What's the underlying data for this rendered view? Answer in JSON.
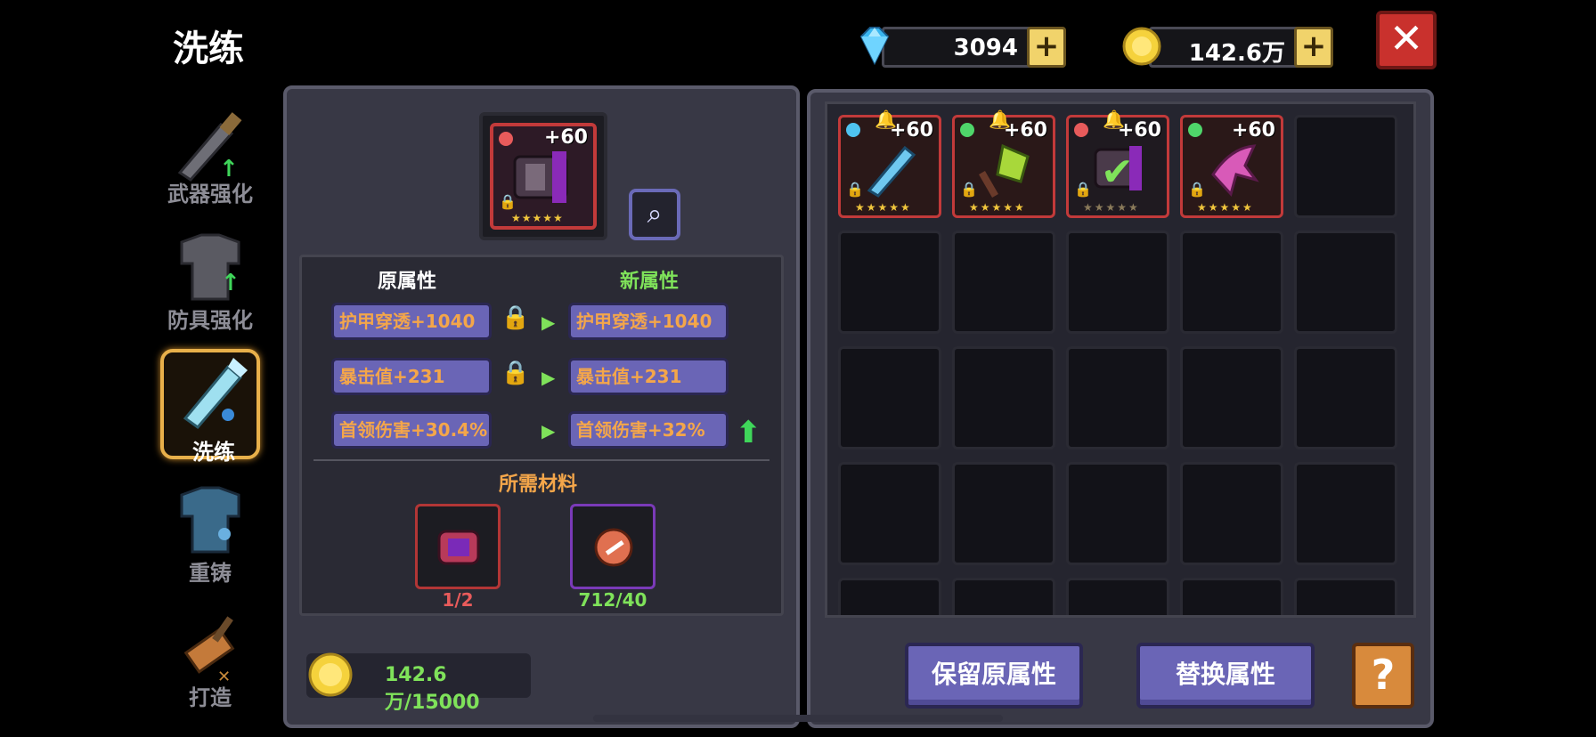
{
  "title": "洗练",
  "currency": {
    "gems": "3094",
    "gold": "142.6万",
    "plus_label": "+"
  },
  "close_label": "✕",
  "nav": [
    {
      "label": "武器强化",
      "icon": "sword-upgrade-icon"
    },
    {
      "label": "防具强化",
      "icon": "armor-upgrade-icon"
    },
    {
      "label": "洗练",
      "icon": "refine-sword-icon",
      "active": true
    },
    {
      "label": "重铸",
      "icon": "recast-armor-icon"
    },
    {
      "label": "打造",
      "icon": "forge-hammer-icon"
    }
  ],
  "equipment": {
    "level": "+60",
    "stars": "★★★★★"
  },
  "stats": {
    "old_header": "原属性",
    "new_header": "新属性",
    "rows": [
      {
        "old": "护甲穿透+1040",
        "new": "护甲穿透+1040",
        "locked": true
      },
      {
        "old": "暴击值+231",
        "new": "暴击值+231",
        "locked": true
      },
      {
        "old": "首领伤害+30.4%",
        "new": "首领伤害+32%",
        "locked": false,
        "improved": true
      }
    ],
    "arrow": "▶",
    "lock_glyph": "🔒",
    "up_glyph": "⬆"
  },
  "materials": {
    "header": "所需材料",
    "items": [
      {
        "count": "1/2",
        "color": "#e85b5b"
      },
      {
        "count": "712/40",
        "color": "#7fe25a"
      }
    ]
  },
  "gold_cost": "142.6万/15000",
  "inventory": [
    {
      "level": "+60",
      "stars": "★★★★★",
      "gem_color": "#4fc3f0",
      "locked": true,
      "pinned": true,
      "art": "ice-blade-icon",
      "selected": false
    },
    {
      "level": "+60",
      "stars": "★★★★★",
      "gem_color": "#4fd66a",
      "locked": true,
      "pinned": true,
      "art": "green-axe-icon",
      "selected": false
    },
    {
      "level": "+60",
      "stars": "★★★★★",
      "gem_color": "#e85b5b",
      "locked": true,
      "pinned": true,
      "art": "dark-gauntlet-icon",
      "selected": true
    },
    {
      "level": "+60",
      "stars": "★★★★★",
      "gem_color": "#4fd66a",
      "locked": true,
      "pinned": false,
      "art": "pink-claw-icon",
      "selected": false
    }
  ],
  "buttons": {
    "keep": "保留原属性",
    "replace": "替换属性",
    "help": "?"
  },
  "colors": {
    "accent_purple": "#6a65b6",
    "text_orange": "#f4a64a",
    "text_green": "#7fe25a",
    "close_red": "#c9312d"
  }
}
